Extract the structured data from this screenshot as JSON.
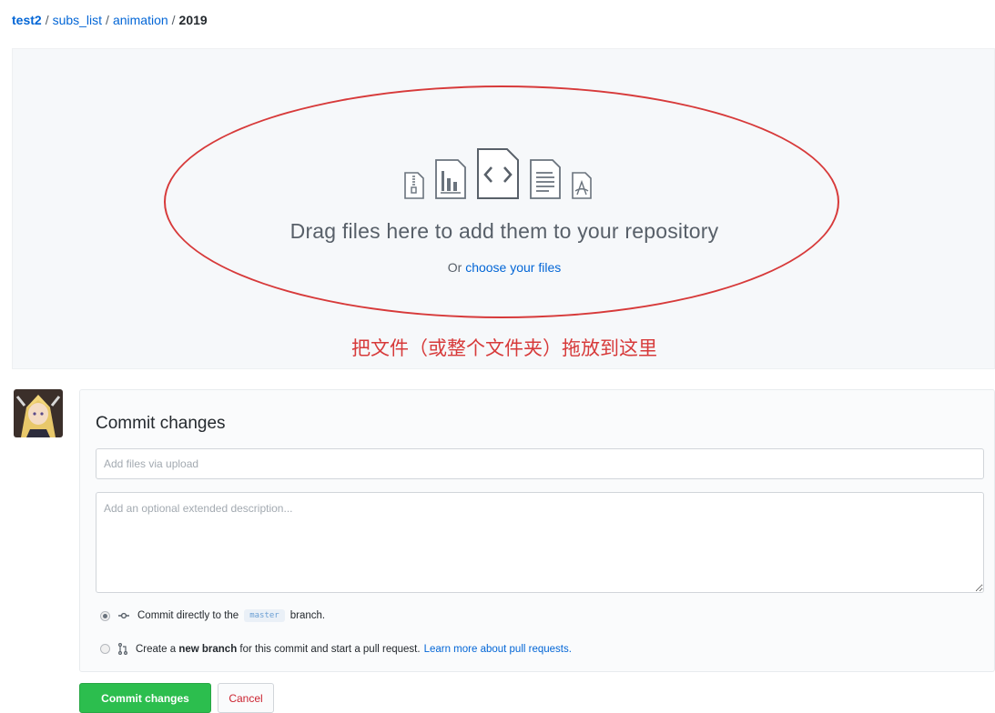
{
  "breadcrumb": {
    "repo": "test2",
    "sep": "/",
    "folder1": "subs_list",
    "folder2": "animation",
    "current": "2019"
  },
  "dropzone": {
    "icons": [
      "zip-file-icon",
      "chart-file-icon",
      "code-file-icon",
      "text-file-icon",
      "pdf-file-icon"
    ],
    "drag_text": "Drag files here to add them to your repository",
    "or_text": "Or",
    "choose_link": "choose your files",
    "annotation": "把文件（或整个文件夹）拖放到这里",
    "annotation_color": "#d73a3a"
  },
  "commit": {
    "title": "Commit changes",
    "summary_placeholder": "Add files via upload",
    "description_placeholder": "Add an optional extended description...",
    "option_direct": {
      "text_before": "Commit directly to the",
      "branch": "master",
      "text_after": "branch.",
      "selected": true
    },
    "option_new_branch": {
      "text_create": "Create a",
      "text_bold": "new branch",
      "text_rest": "for this commit and start a pull request.",
      "link": "Learn more about pull requests.",
      "selected": false
    },
    "commit_button": "Commit changes",
    "cancel_button": "Cancel"
  },
  "colors": {
    "link": "#0366d6",
    "primary_button": "#2cbe4e",
    "cancel_text": "#cb2431"
  }
}
